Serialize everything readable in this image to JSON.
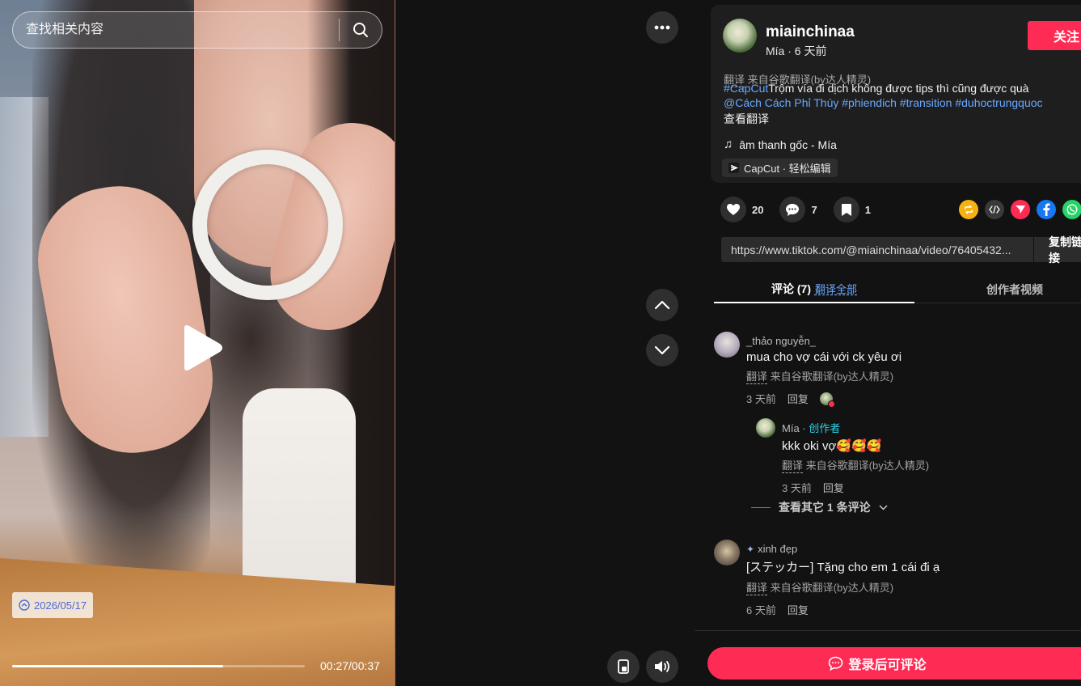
{
  "search": {
    "placeholder": "查找相关内容"
  },
  "player": {
    "date_badge": "2026/05/17",
    "time": "00:27/00:37",
    "progress": 0.72,
    "play_icon": "play-icon",
    "more_icon": "more-horizontal-icon"
  },
  "post": {
    "username": "miainchinaa",
    "subline": "Mía · 6 天前",
    "follow_label": "关注",
    "translate_label": "翻译",
    "translate_source": "来自谷歌翻译(by达人精灵)",
    "caption_tag1": "#CapCut",
    "caption_text1": "Trộm vía đi dịch không được tips thì cũng được quà",
    "caption_tags2": "@Cách Cách Phỉ Thúy #phiendich #transition #duhoctrungquoc",
    "see_translation": "查看翻译",
    "music": "âm thanh gốc - Mía",
    "capcut_chip": "CapCut · 轻松编辑"
  },
  "actions": {
    "likes": "20",
    "comments": "7",
    "saves": "1"
  },
  "share": {
    "link": "https://www.tiktok.com/@miainchinaa/video/76405432...",
    "copy_label": "复制链接"
  },
  "tabs": {
    "comments_label": "评论 (7)",
    "translate_all": "翻译全部",
    "creator_videos": "创作者视频"
  },
  "comments": [
    {
      "user": "_thảo nguyễn_",
      "text": "mua cho vợ cái với ck yêu ơi",
      "translate_label": "翻译",
      "translate_source": "来自谷歌翻译(by达人精灵)",
      "time": "3 天前",
      "reply": "回复"
    },
    {
      "user": "Mía · ",
      "creator_tag": "创作者",
      "text": "kkk oki vợ🥰🥰🥰",
      "translate_label": "翻译",
      "translate_source": "来自谷歌翻译(by达人精灵)",
      "time": "3 天前",
      "reply": "回复"
    },
    {
      "user": "xinh đẹp",
      "text": "[ステッカー] Tặng cho em 1 cái đi ạ",
      "translate_label": "翻译",
      "translate_source": "来自谷歌翻译(by达人精灵)",
      "time": "6 天前",
      "reply": "回复"
    }
  ],
  "more_replies": "查看其它 1 条评论",
  "login_label": "登录后可评论",
  "colors": {
    "accent": "#fe2c55",
    "link": "#6aa8ff",
    "creator": "#29d3e8"
  }
}
